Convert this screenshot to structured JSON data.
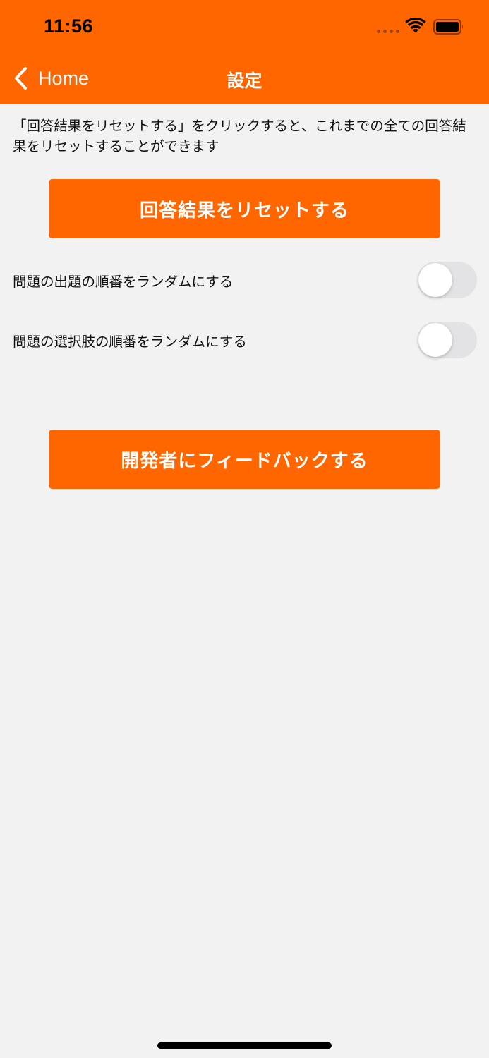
{
  "status_bar": {
    "time": "11:56"
  },
  "nav": {
    "back_label": "Home",
    "title": "設定"
  },
  "description": "「回答結果をリセットする」をクリックすると、これまでの全ての回答結果をリセットすることができます",
  "buttons": {
    "reset_label": "回答結果をリセットする",
    "feedback_label": "開発者にフィードバックする"
  },
  "settings": [
    {
      "label": "問題の出題の順番をランダムにする",
      "enabled": false
    },
    {
      "label": "問題の選択肢の順番をランダムにする",
      "enabled": false
    }
  ],
  "colors": {
    "accent": "#ff6600",
    "background": "#f2f2f2",
    "toggle_off": "#e3e3e6"
  },
  "icons": [
    "signal-icon",
    "wifi-icon",
    "battery-icon",
    "chevron-left-icon"
  ]
}
